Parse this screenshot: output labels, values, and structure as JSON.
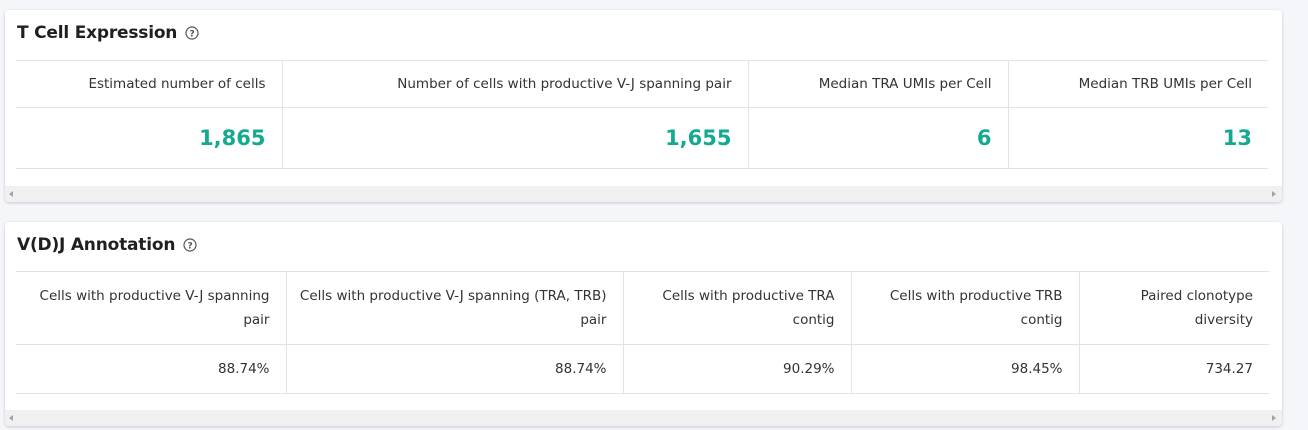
{
  "tcell": {
    "title": "T Cell Expression",
    "help_icon": "question-circle-icon",
    "headers": [
      "Estimated number of cells",
      "Number of cells with productive V-J spanning pair",
      "Median TRA UMIs per Cell",
      "Median TRB UMIs per Cell"
    ],
    "values": [
      "1,865",
      "1,655",
      "6",
      "13"
    ],
    "value_color": "#16a992"
  },
  "vdj": {
    "title": "V(D)J Annotation",
    "help_icon": "question-circle-icon",
    "headers": [
      "Cells with productive V-J spanning pair",
      "Cells with productive V-J spanning (TRA, TRB) pair",
      "Cells with productive TRA contig",
      "Cells with productive TRB contig",
      "Paired clonotype diversity"
    ],
    "values": [
      "88.74%",
      "88.74%",
      "90.29%",
      "98.45%",
      "734.27"
    ]
  }
}
